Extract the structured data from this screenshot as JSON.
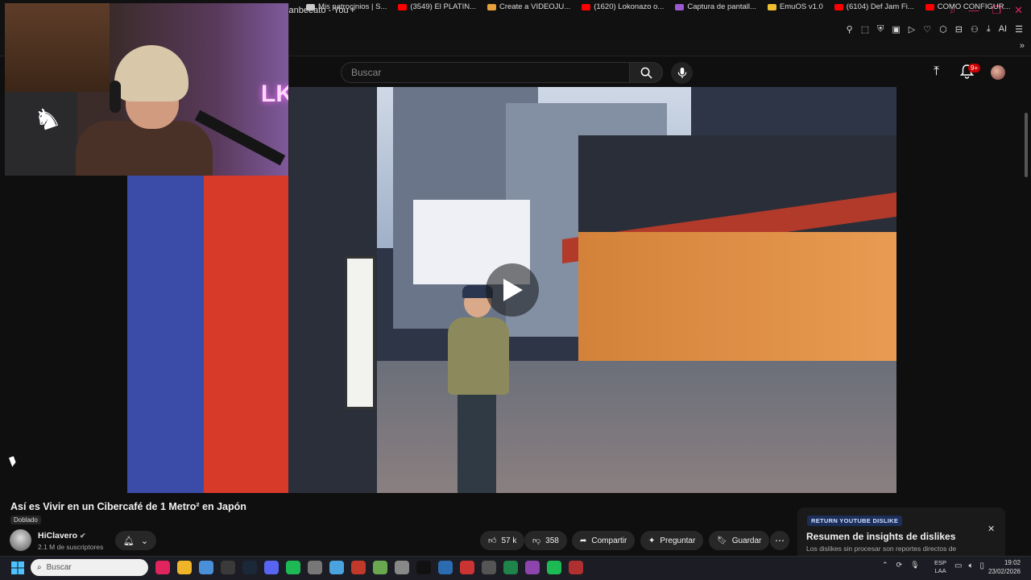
{
  "browser": {
    "active_tab": "juanbeeato - YouT",
    "new_tab_symbol": "+",
    "bookmarks": [
      {
        "label": "Mis patrocinios | S...",
        "color": "#cccccc"
      },
      {
        "label": "(3549) El PLATIN...",
        "color": "#ff0000"
      },
      {
        "label": "Create a VIDEOJU...",
        "color": "#e8a13a"
      },
      {
        "label": "(1620) Lokonazo o...",
        "color": "#ff0000"
      },
      {
        "label": "Captura de pantall...",
        "color": "#9b59d0"
      },
      {
        "label": "EmuOS v1.0",
        "color": "#f0c030"
      },
      {
        "label": "(6104) Def Jam Fi...",
        "color": "#ff0000"
      },
      {
        "label": "COMO CONFIGUR...",
        "color": "#ff0000"
      }
    ],
    "toolbar_label": "AI"
  },
  "youtube": {
    "search_placeholder": "Buscar",
    "notifications_badge": "9+",
    "video": {
      "title": "Así es Vivir en un Cibercafé de 1 Metro² en Japón",
      "dubbed_label": "Doblado"
    },
    "channel": {
      "name": "HiClavero",
      "subscribers": "2.1 M de suscriptores"
    },
    "actions": {
      "likes": "57 k",
      "dislikes": "358",
      "share": "Compartir",
      "ask": "Preguntar",
      "save": "Guardar"
    },
    "return_dislike": {
      "tag": "RETURN YOUTUBE DISLIKE",
      "title": "Resumen de insights de dislikes",
      "text": "Los dislikes sin procesar son reportes directos de"
    }
  },
  "webcam": {
    "neon_text": "LKZ"
  },
  "taskbar": {
    "search_placeholder": "Buscar",
    "apps": [
      "#e0245e",
      "#f0b429",
      "#4a90d9",
      "#3a3a3a",
      "#1b2838",
      "#5865f2",
      "#1db954",
      "#777",
      "#4aa3df",
      "#c0392b",
      "#6aa84f",
      "#888",
      "#111",
      "#2b6cb0",
      "#cc3333",
      "#555",
      "#1e8449",
      "#8e44ad",
      "#1db954",
      "#b03030"
    ],
    "language": "ESP",
    "language_sub": "LAA",
    "time": "19:02",
    "date": "23/02/2026"
  }
}
